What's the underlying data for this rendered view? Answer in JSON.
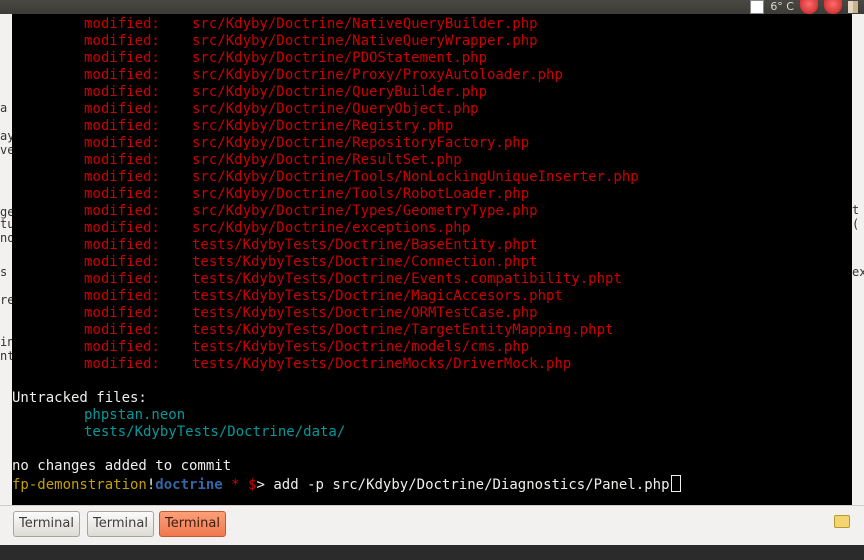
{
  "tray": {
    "temperature": "6° C"
  },
  "bg_left_fragments": [
    "a",
    "ay",
    "ve",
    "ge",
    "tu",
    "no",
    "s",
    "re",
    "in",
    "nt"
  ],
  "bg_right_fragments": [
    "t",
    "(",
    "ex"
  ],
  "terminal": {
    "modified_label": "modified:",
    "modified_files": [
      "src/Kdyby/Doctrine/NativeQueryBuilder.php",
      "src/Kdyby/Doctrine/NativeQueryWrapper.php",
      "src/Kdyby/Doctrine/PDOStatement.php",
      "src/Kdyby/Doctrine/Proxy/ProxyAutoloader.php",
      "src/Kdyby/Doctrine/QueryBuilder.php",
      "src/Kdyby/Doctrine/QueryObject.php",
      "src/Kdyby/Doctrine/Registry.php",
      "src/Kdyby/Doctrine/RepositoryFactory.php",
      "src/Kdyby/Doctrine/ResultSet.php",
      "src/Kdyby/Doctrine/Tools/NonLockingUniqueInserter.php",
      "src/Kdyby/Doctrine/Tools/RobotLoader.php",
      "src/Kdyby/Doctrine/Types/GeometryType.php",
      "src/Kdyby/Doctrine/exceptions.php",
      "tests/KdybyTests/Doctrine/BaseEntity.phpt",
      "tests/KdybyTests/Doctrine/Connection.phpt",
      "tests/KdybyTests/Doctrine/Events.compatibility.phpt",
      "tests/KdybyTests/Doctrine/MagicAccesors.phpt",
      "tests/KdybyTests/Doctrine/ORMTestCase.php",
      "tests/KdybyTests/Doctrine/TargetEntityMapping.phpt",
      "tests/KdybyTests/Doctrine/models/cms.php",
      "tests/KdybyTests/DoctrineMocks/DriverMock.php"
    ],
    "untracked_header": "Untracked files:",
    "untracked_files": [
      "phpstan.neon",
      "tests/KdybyTests/Doctrine/data/"
    ],
    "no_changes": "no changes added to commit",
    "prompt": {
      "user": "fp-demonstration",
      "sep": "!",
      "dir": "doctrine",
      "star": "*",
      "dollar": "$",
      "arrow": ">",
      "command": " add -p src/Kdyby/Doctrine/Diagnostics/Panel.php"
    }
  },
  "taskbar": {
    "buttons": [
      "Terminal",
      "Terminal",
      "Terminal"
    ],
    "active_index": 2
  },
  "colors": {
    "modified": "#cc0000",
    "untracked": "#06989a",
    "prompt_user": "#c4a000",
    "prompt_dir": "#3465a4",
    "active_task": "#f0794f"
  }
}
